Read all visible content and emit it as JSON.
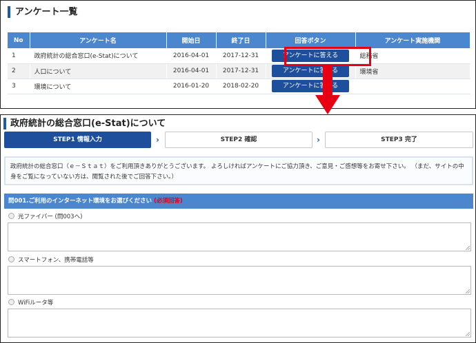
{
  "list": {
    "title": "アンケート一覧",
    "columns": [
      "No",
      "アンケート名",
      "開始日",
      "終了日",
      "回答ボタン",
      "アンケート実施機関"
    ],
    "rows": [
      {
        "no": "1",
        "name": "政府統計の総合窓口(e-Stat)について",
        "start": "2016-04-01",
        "end": "2017-12-31",
        "button": "アンケートに答える",
        "agency": "総務省"
      },
      {
        "no": "2",
        "name": "人口について",
        "start": "2016-04-01",
        "end": "2017-12-31",
        "button": "アンケートに答える",
        "agency": "環境省"
      },
      {
        "no": "3",
        "name": "環境について",
        "start": "2016-01-20",
        "end": "2018-02-20",
        "button": "アンケートに答える",
        "agency": ""
      }
    ]
  },
  "annotation": {
    "highlight_color": "#e60012",
    "arrow_color": "#e60012"
  },
  "form": {
    "title": "政府統計の総合窓口(e-Stat)について",
    "steps": [
      "STEP1 情報入力",
      "STEP2 確認",
      "STEP3 完了"
    ],
    "intro": "政府統計の総合窓口（ｅ－Ｓｔａｔ）をご利用頂きありがとうございます。 よろしければアンケートにご協力頂き、ご意見・ご感想等をお寄せ下さい。 （まだ、サイトの中身をご覧になっていない方は、閲覧された後でご回答下さい。）",
    "question": "問001.ご利用のインターネット環境をお選びください",
    "required": "(必須回答)",
    "options": [
      "光ファイバー (問003へ)",
      "スマートフォン、携帯電話等",
      "WiFiルータ等"
    ]
  },
  "colors": {
    "header_blue": "#4b87cf",
    "button_navy": "#1d4f9c",
    "accent_red": "#e60012"
  },
  "icons": {
    "step_separator": "chevron-right-icon",
    "option_marker": "radio-icon",
    "annotation_arrow": "arrow-down-icon"
  }
}
